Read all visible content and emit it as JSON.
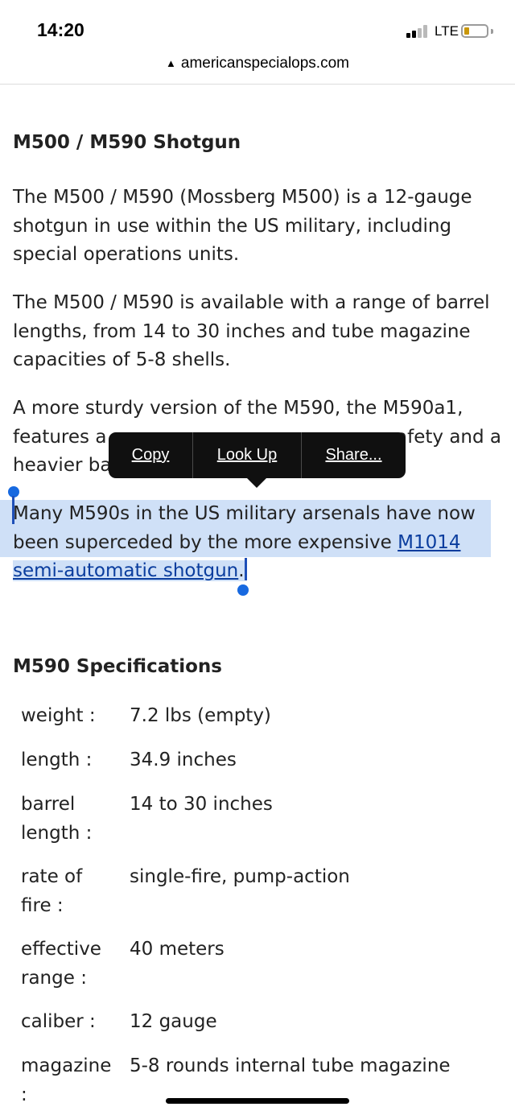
{
  "status": {
    "time": "14:20",
    "network": "LTE"
  },
  "browser": {
    "url": "americanspecialops.com",
    "lock_glyph": "▲"
  },
  "article": {
    "title": "M500 / M590 Shotgun",
    "p1_lines": [
      "The M500 / M590 (Mossberg M500) is a 12-gauge",
      "shotgun in use within the US military, including",
      "special operations units."
    ],
    "p2_lines": [
      "The M500 / M590 is available with a range of barrel",
      "lengths, from 14 to 30 inches and tube magazine",
      "capacities of 5-8 shells."
    ],
    "p3_line1": "A more sturdy version of the M590, the M590a1,",
    "p3_line2_start": "features a",
    "p3_line2_end": "afety and a",
    "p3_line3_start": "heavier ba",
    "p4_line1": "Many M590s in the US military arsenals have now",
    "p4_line2_text": "been superceded by the more expensive ",
    "p4_link1": "M1014",
    "p4_link2": "semi-automatic shotgun",
    "p4_end": "."
  },
  "context_menu": {
    "copy": "Copy",
    "look_up": "Look Up",
    "share": "Share..."
  },
  "specs": {
    "title": "M590 Specifications",
    "rows": [
      {
        "label": "weight :",
        "value": "7.2 lbs (empty)"
      },
      {
        "label": "length :",
        "value": "34.9 inches"
      },
      {
        "label_l1": "barrel",
        "label_l2": "length :",
        "value": "14 to 30 inches"
      },
      {
        "label_l1": "rate of",
        "label_l2": "fire :",
        "value": "single-fire, pump-action"
      },
      {
        "label_l1": "effective",
        "label_l2": "range :",
        "value": "40 meters"
      },
      {
        "label": "caliber :",
        "value": "12 gauge"
      },
      {
        "label_l1": "magazine",
        "label_l2": ":",
        "value": "5-8 rounds internal tube magazine"
      }
    ]
  },
  "colors": {
    "selection": "#cfe0f7",
    "link": "#0a3d9e",
    "handle": "#1769e0",
    "menu_bg": "#101010"
  },
  "icons": [
    "signal-icon",
    "battery-icon",
    "lock-icon"
  ]
}
